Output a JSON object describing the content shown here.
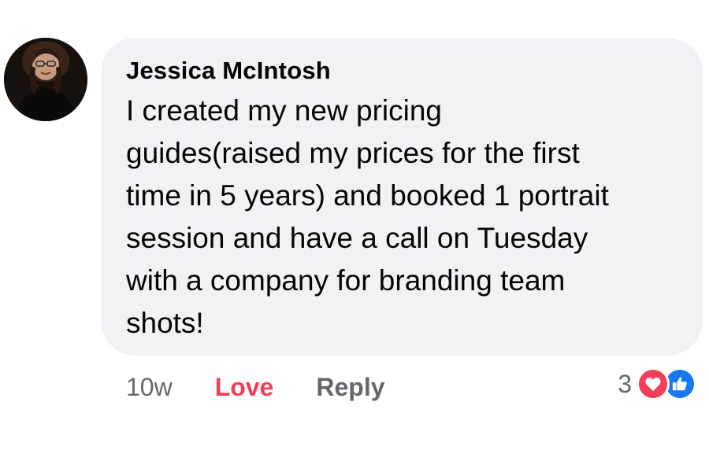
{
  "comment": {
    "author": "Jessica McIntosh",
    "text": "I created my new pricing\nguides(raised my prices for the first\ntime in 5 years) and booked 1 portrait\nsession and have a call on Tuesday\nwith a company for branding team\nshots!",
    "avatar_icon": "profile-photo"
  },
  "actions": {
    "time": "10w",
    "love_label": "Love",
    "reply_label": "Reply"
  },
  "reactions": {
    "count": "3",
    "types": [
      "love",
      "like"
    ]
  },
  "colors": {
    "bubble": "#f0f2f5",
    "love": "#f33e58",
    "like": "#1877f2",
    "muted": "#65676b"
  }
}
